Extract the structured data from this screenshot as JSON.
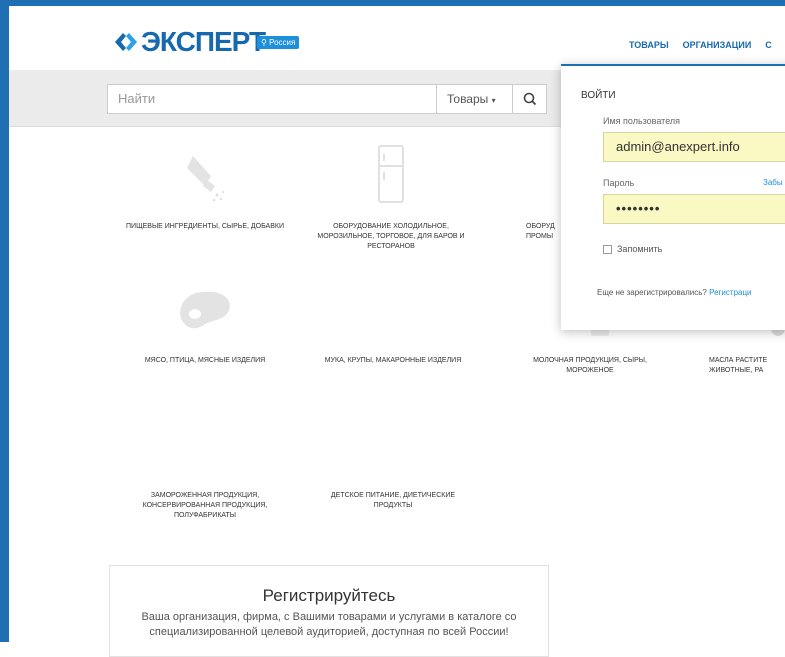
{
  "header": {
    "logo_text": "ЭКСПЕРТ",
    "region_badge": "Россия",
    "nav": [
      "ТОВАРЫ",
      "ОРГАНИЗАЦИИ",
      "С"
    ]
  },
  "search": {
    "placeholder": "Найти",
    "scope": "Товары",
    "scope_caret": "▾"
  },
  "categories": [
    {
      "label": "ПИЩЕВЫЕ ИНГРЕДИЕНТЫ, СЫРЬЕ, ДОБАВКИ"
    },
    {
      "label": "ОБОРУДОВАНИЕ ХОЛОДИЛЬНОЕ, МОРОЗИЛЬНОЕ, ТОРГОВОЕ, ДЛЯ БАРОВ И РЕСТОРАНОВ"
    },
    {
      "label": "ОБОРУД ПРОМЫ"
    },
    {
      "label": "МЯСО, ПТИЦА, МЯСНЫЕ ИЗДЕЛИЯ"
    },
    {
      "label": "МУКА, КРУПЫ, МАКАРОННЫЕ ИЗДЕЛИЯ"
    },
    {
      "label": "МОЛОЧНАЯ ПРОДУКЦИЯ, СЫРЫ, МОРОЖЕНОЕ"
    },
    {
      "label": "МАСЛА РАСТИТЕ ЖИВОТНЫЕ, РА"
    },
    {
      "label": "ЗАМОРОЖЕННАЯ ПРОДУКЦИЯ, КОНСЕРВИРОВАННАЯ ПРОДУКЦИЯ, ПОЛУФАБРИКАТЫ"
    },
    {
      "label": "ДЕТСКОЕ ПИТАНИЕ, ДИЕТИЧЕСКИЕ ПРОДУКТЫ"
    }
  ],
  "register": {
    "title": "Регистрируйтесь",
    "text": "Ваша организация, фирма, с Вашими товарами и услугами в каталоге со специализированной целевой аудиторией, доступная по всей России!"
  },
  "login": {
    "title": "ВОЙТИ",
    "username_label": "Имя пользователя",
    "username_value": "admin@anexpert.info",
    "password_label": "Пароль",
    "forgot_label": "Забы",
    "password_value": "••••••••",
    "remember_label": "Запомнить",
    "not_registered": "Еще не зарегистрировались?",
    "register_link": "Регистраци"
  },
  "colors": {
    "brand": "#1769ae",
    "frame": "#1e6fb3",
    "autofill": "#faf8c3"
  }
}
